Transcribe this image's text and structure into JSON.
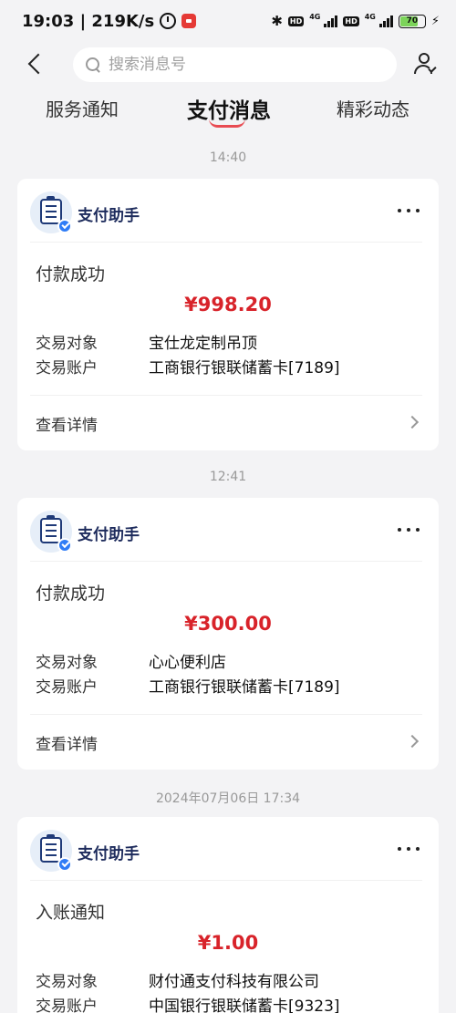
{
  "status_bar": {
    "time_speed": "19:03 | 219K/s",
    "network_1": "4G",
    "network_2": "4G",
    "hd_label": "HD",
    "battery": "70",
    "battery_level": 0.7
  },
  "header": {
    "search_placeholder": "搜索消息号"
  },
  "tabs": [
    {
      "label": "服务通知"
    },
    {
      "label": "支付消息",
      "active": true
    },
    {
      "label": "精彩动态"
    }
  ],
  "accent_color": "#e84b52",
  "messages": [
    {
      "time": "14:40",
      "sender": "支付助手",
      "title": "付款成功",
      "amount": "¥998.20",
      "fields": [
        {
          "label": "交易对象",
          "value": "宝仕龙定制吊顶"
        },
        {
          "label": "交易账户",
          "value": "工商银行银联储蓄卡[7189]"
        }
      ],
      "detail_label": "查看详情"
    },
    {
      "time": "12:41",
      "sender": "支付助手",
      "title": "付款成功",
      "amount": "¥300.00",
      "fields": [
        {
          "label": "交易对象",
          "value": "心心便利店"
        },
        {
          "label": "交易账户",
          "value": "工商银行银联储蓄卡[7189]"
        }
      ],
      "detail_label": "查看详情"
    },
    {
      "time": "2024年07月06日 17:34",
      "sender": "支付助手",
      "title": "入账通知",
      "amount": "¥1.00",
      "fields": [
        {
          "label": "交易对象",
          "value": "财付通支付科技有限公司"
        },
        {
          "label": "交易账户",
          "value": "中国银行银联储蓄卡[9323]"
        }
      ]
    }
  ]
}
